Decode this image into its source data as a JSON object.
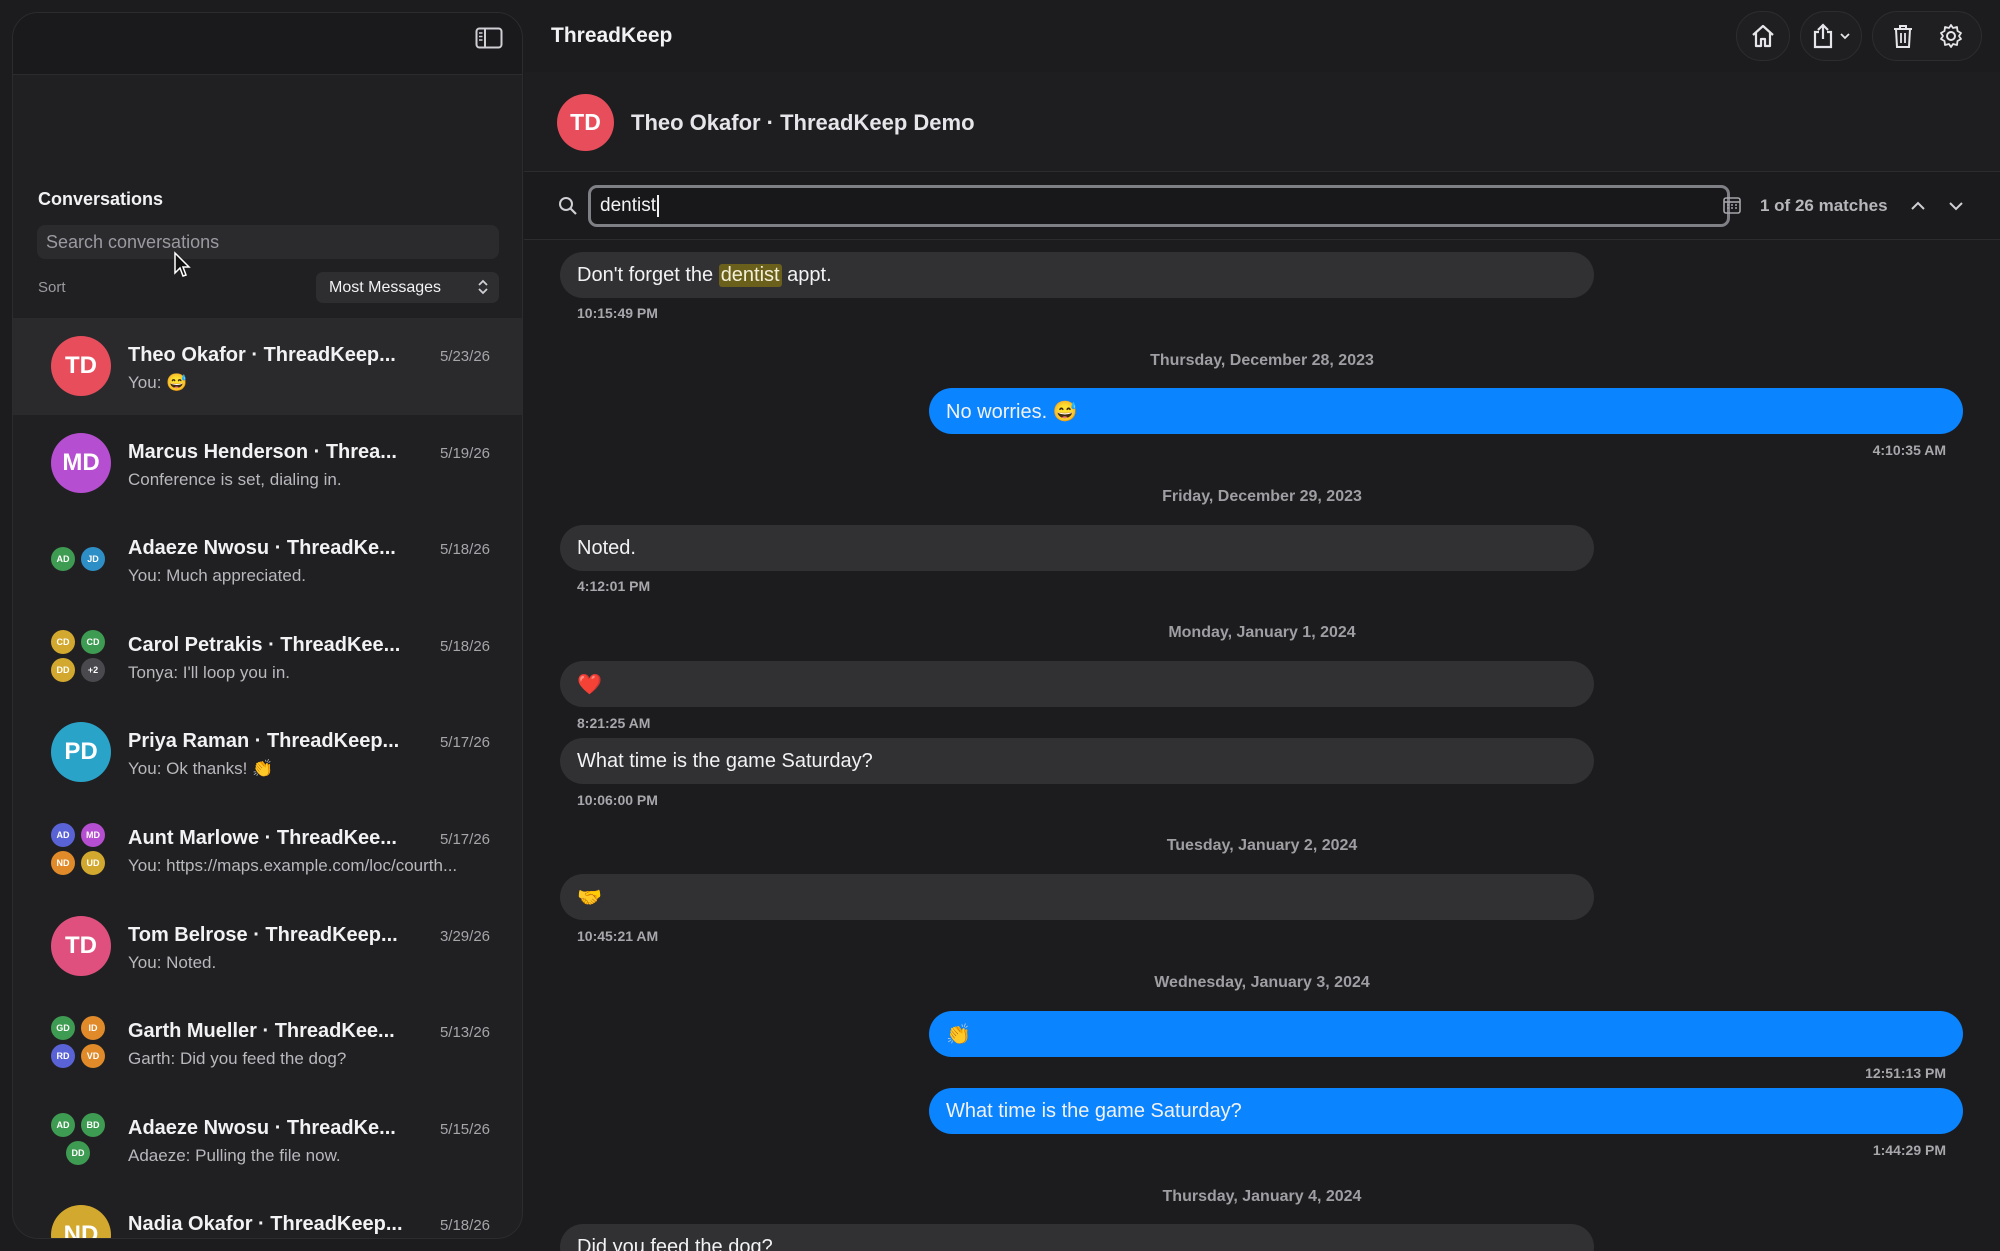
{
  "app": {
    "title": "ThreadKeep"
  },
  "sidebar": {
    "section_title": "Conversations",
    "search_placeholder": "Search conversations",
    "sort_label": "Sort",
    "sort_value": "Most Messages",
    "conversations": [
      {
        "name": "Theo Okafor · ThreadKeep...",
        "date": "5/23/26",
        "preview": "You: 😅",
        "initials": "TD",
        "color": "#e84d5c",
        "active": true
      },
      {
        "name": "Marcus Henderson · Threa...",
        "date": "5/19/26",
        "preview": "Conference is set, dialing in.",
        "initials": "MD",
        "color": "#b54ed0"
      },
      {
        "name": "Adaeze Nwosu · ThreadKe...",
        "date": "5/18/26",
        "preview": "You: Much appreciated.",
        "group": [
          {
            "i": "AD",
            "c": "#3e9b52"
          },
          {
            "i": "JD",
            "c": "#2e8fc7"
          }
        ]
      },
      {
        "name": "Carol Petrakis · ThreadKee...",
        "date": "5/18/26",
        "preview": "Tonya: I'll loop you in.",
        "group": [
          {
            "i": "CD",
            "c": "#d3a82e"
          },
          {
            "i": "CD",
            "c": "#3e9b52"
          },
          {
            "i": "DD",
            "c": "#d3a82e"
          },
          {
            "i": "+2",
            "c": "#4a4a4e"
          }
        ]
      },
      {
        "name": "Priya Raman · ThreadKeep...",
        "date": "5/17/26",
        "preview": "You: Ok thanks! 👏",
        "initials": "PD",
        "color": "#2aa3c9"
      },
      {
        "name": "Aunt Marlowe · ThreadKee...",
        "date": "5/17/26",
        "preview": "You: https://maps.example.com/loc/courth...",
        "group": [
          {
            "i": "AD",
            "c": "#5a63d6"
          },
          {
            "i": "MD",
            "c": "#b54ed0"
          },
          {
            "i": "ND",
            "c": "#e08a2a"
          },
          {
            "i": "UD",
            "c": "#d3a82e"
          }
        ]
      },
      {
        "name": "Tom Belrose · ThreadKeep...",
        "date": "3/29/26",
        "preview": "You: Noted.",
        "initials": "TD",
        "color": "#e0507e"
      },
      {
        "name": "Garth Mueller · ThreadKee...",
        "date": "5/13/26",
        "preview": "Garth: Did you feed the dog?",
        "group": [
          {
            "i": "GD",
            "c": "#3e9b52"
          },
          {
            "i": "ID",
            "c": "#e08a2a"
          },
          {
            "i": "RD",
            "c": "#5a63d6"
          },
          {
            "i": "VD",
            "c": "#e08a2a"
          }
        ]
      },
      {
        "name": "Adaeze Nwosu · ThreadKe...",
        "date": "5/15/26",
        "preview": "Adaeze: Pulling the file now.",
        "group": [
          {
            "i": "AD",
            "c": "#3e9b52"
          },
          {
            "i": "BD",
            "c": "#3e9b52"
          },
          {
            "i": "DD",
            "c": "#3e9b52"
          }
        ]
      },
      {
        "name": "Nadia Okafor · ThreadKeep...",
        "date": "5/18/26",
        "preview": "",
        "initials": "ND",
        "color": "#d3a82e"
      }
    ]
  },
  "chat": {
    "avatar_initials": "TD",
    "title": "Theo Okafor · ThreadKeep Demo",
    "find": {
      "query": "dentist",
      "match_text": "1 of 26 matches"
    },
    "messages": {
      "m1": {
        "before": "Don't forget the ",
        "hit": "dentist",
        "after": " appt.",
        "time": "10:15:49 PM"
      },
      "d1": "Thursday, December 28, 2023",
      "m2": {
        "text": "No worries. 😅",
        "time": "4:10:35 AM"
      },
      "d2": "Friday, December 29, 2023",
      "m3": {
        "text": "Noted.",
        "time": "4:12:01 PM"
      },
      "d3": "Monday, January 1, 2024",
      "m4": {
        "text": "❤️",
        "time": "8:21:25 AM"
      },
      "m5": {
        "text": "What time is the game Saturday?",
        "time": "10:06:00 PM"
      },
      "d4": "Tuesday, January 2, 2024",
      "m6": {
        "text": "🤝",
        "time": "10:45:21 AM"
      },
      "d5": "Wednesday, January 3, 2024",
      "m7": {
        "text": "👏",
        "time": "12:51:13 PM"
      },
      "m8": {
        "text": "What time is the game Saturday?",
        "time": "1:44:29 PM"
      },
      "d6": "Thursday, January 4, 2024",
      "m9": {
        "text": "Did you feed the dog?"
      }
    }
  },
  "icons": [
    "sidebar-toggle-icon",
    "home-icon",
    "share-icon",
    "chevron-down-icon",
    "trash-icon",
    "gear-icon",
    "search-icon",
    "calendar-icon",
    "chevron-up-icon"
  ]
}
